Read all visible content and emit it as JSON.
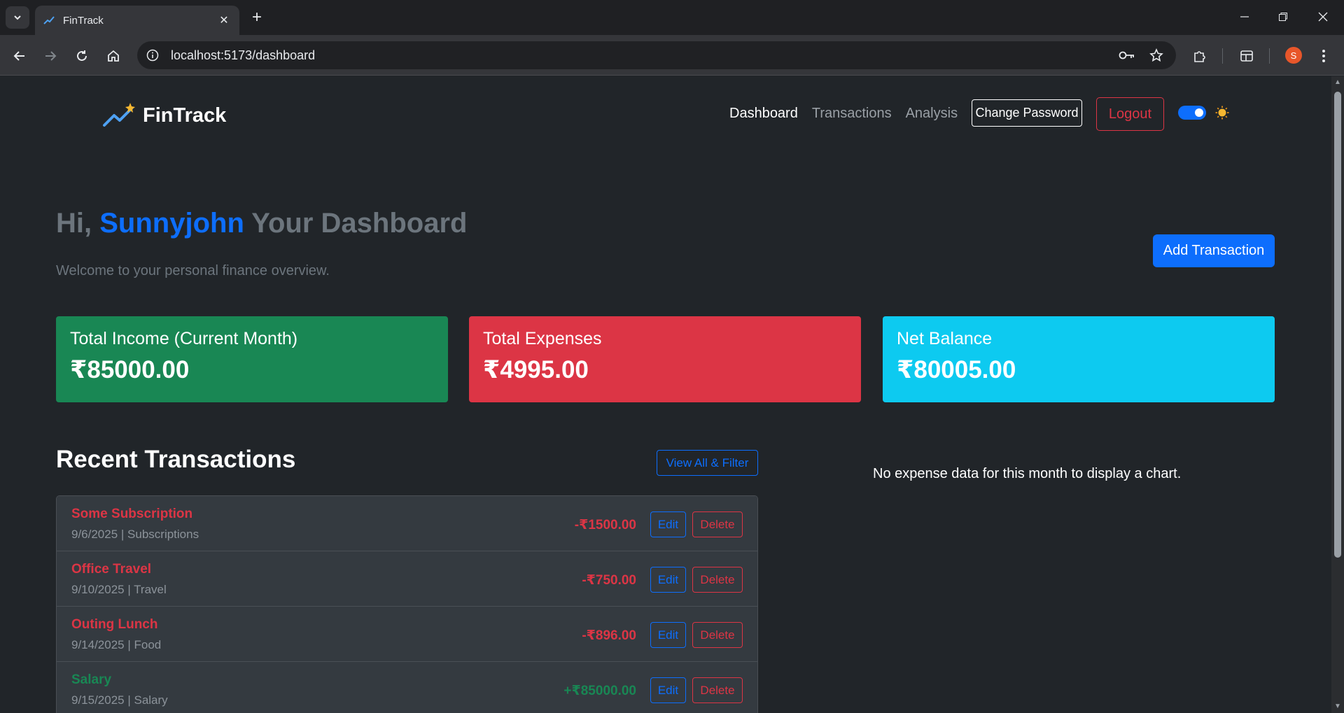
{
  "browser": {
    "tab_title": "FinTrack",
    "url": "localhost:5173/dashboard",
    "profile_initial": "S"
  },
  "navbar": {
    "brand": "FinTrack",
    "links": [
      "Dashboard",
      "Transactions",
      "Analysis"
    ],
    "active_link": "Dashboard",
    "change_password": "Change Password",
    "logout": "Logout",
    "theme_toggle_on": true
  },
  "header": {
    "greeting_prefix": "Hi,",
    "username": "Sunnyjohn",
    "greeting_suffix": "Your Dashboard",
    "subtitle": "Welcome to your personal finance overview.",
    "add_button": "Add Transaction"
  },
  "cards": [
    {
      "title": "Total Income (Current Month)",
      "value": "₹85000.00",
      "color": "#198754"
    },
    {
      "title": "Total Expenses",
      "value": "₹4995.00",
      "color": "#dc3545"
    },
    {
      "title": "Net Balance",
      "value": "₹80005.00",
      "color": "#0dcaf0"
    }
  ],
  "recent": {
    "title": "Recent Transactions",
    "view_all": "View All & Filter",
    "edit_label": "Edit",
    "delete_label": "Delete",
    "items": [
      {
        "name": "Some Subscription",
        "meta": "9/6/2025 | Subscriptions",
        "amount": "-₹1500.00",
        "type": "expense"
      },
      {
        "name": "Office Travel",
        "meta": "9/10/2025 | Travel",
        "amount": "-₹750.00",
        "type": "expense"
      },
      {
        "name": "Outing Lunch",
        "meta": "9/14/2025 | Food",
        "amount": "-₹896.00",
        "type": "expense"
      },
      {
        "name": "Salary",
        "meta": "9/15/2025 | Salary",
        "amount": "+₹85000.00",
        "type": "income"
      }
    ]
  },
  "chart_message": "No expense data for this month to display a chart.",
  "colors": {
    "background": "#212529",
    "primary": "#0d6efd",
    "danger": "#dc3545",
    "success": "#198754",
    "info": "#0dcaf0"
  }
}
